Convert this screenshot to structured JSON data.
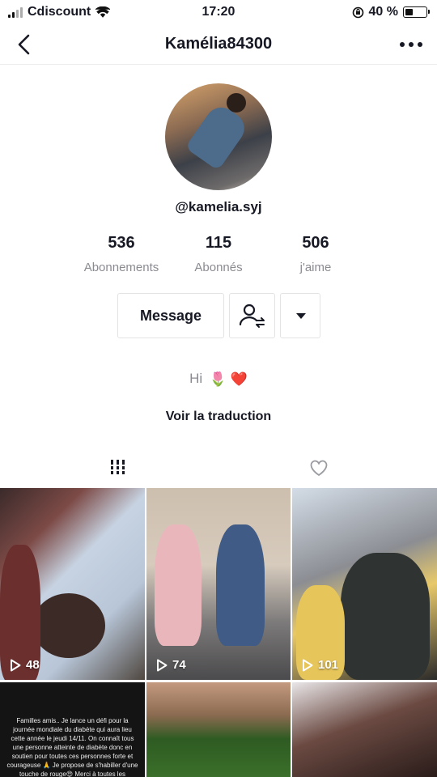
{
  "status_bar": {
    "carrier": "Cdiscount",
    "time": "17:20",
    "battery_percent_text": "40 %",
    "battery_level": 0.4
  },
  "header": {
    "title": "Kamélia84300"
  },
  "profile": {
    "handle": "@kamelia.syj",
    "stats": [
      {
        "value": "536",
        "label": "Abonnements"
      },
      {
        "value": "115",
        "label": "Abonnés"
      },
      {
        "value": "506",
        "label": "j'aime"
      }
    ],
    "message_label": "Message",
    "bio_text": "Hi",
    "bio_emojis": "🌷 ❤️",
    "translate_label": "Voir la traduction"
  },
  "colors": {
    "text": "#161823",
    "muted": "#8a8b91",
    "border": "#e3e3e4"
  },
  "videos": [
    {
      "plays": "48"
    },
    {
      "plays": "74"
    },
    {
      "plays": "101"
    },
    {
      "text_preview": "Familles amis.. Je lance un défi pour la journée mondiale du diabète qui aura lieu cette année le jeudi 14/11. On connaît tous une personne atteinte de diabète donc en soutien pour toutes ces personnes forte et courageuse 🙏 Je propose de s'habiller d'une touche de rouge😍 Merci à toutes les personnes qui participeront a ce défi"
    },
    {},
    {}
  ]
}
